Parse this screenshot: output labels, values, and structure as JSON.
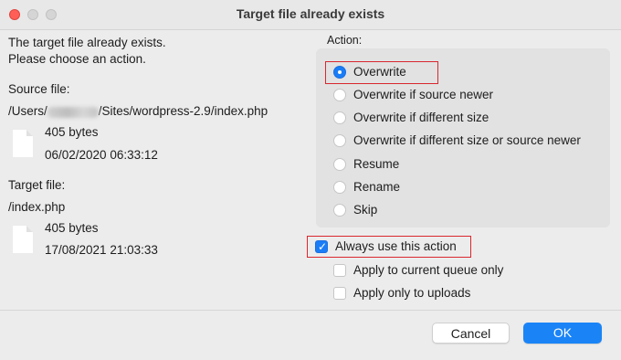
{
  "window": {
    "title": "Target file already exists"
  },
  "intro": {
    "line1": "The target file already exists.",
    "line2": "Please choose an action."
  },
  "source": {
    "heading": "Source file:",
    "path_prefix": "/Users/",
    "path_suffix": "/Sites/wordpress-2.9/index.php",
    "size": "405 bytes",
    "date": "06/02/2020 06:33:12",
    "icon": "document-icon"
  },
  "target": {
    "heading": "Target file:",
    "path": "/index.php",
    "size": "405 bytes",
    "date": "17/08/2021 21:03:33",
    "icon": "document-icon"
  },
  "action": {
    "heading": "Action:",
    "selected": "Overwrite",
    "options": [
      "Overwrite",
      "Overwrite if source newer",
      "Overwrite if different size",
      "Overwrite if different size or source newer",
      "Resume",
      "Rename",
      "Skip"
    ]
  },
  "options": {
    "always_use": {
      "label": "Always use this action",
      "checked": true
    },
    "current_queue": {
      "label": "Apply to current queue only",
      "checked": false
    },
    "uploads_only": {
      "label": "Apply only to uploads",
      "checked": false
    }
  },
  "buttons": {
    "cancel": "Cancel",
    "ok": "OK"
  },
  "colors": {
    "accent": "#1a7df7",
    "highlight": "#d9272e",
    "close": "#ff5f57"
  }
}
